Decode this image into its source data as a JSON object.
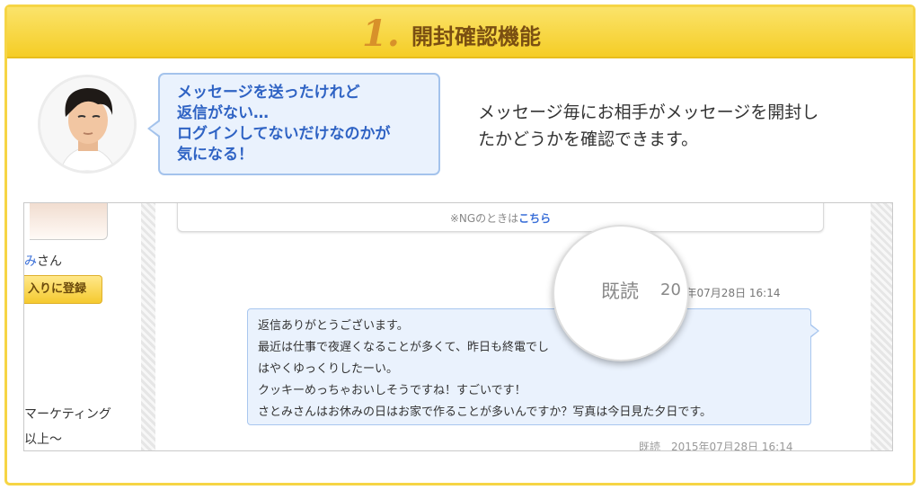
{
  "header": {
    "number": "1.",
    "title": "開封確認機能"
  },
  "bubble": {
    "lines": [
      "メッセージを送ったけれど",
      "返信がない…",
      "ログインしてないだけなのかが",
      "気になる！"
    ]
  },
  "description": {
    "lines": [
      "メッセージ毎にお相手がメッセージを開封し",
      "たかどうかを確認できます。"
    ]
  },
  "screenshot": {
    "notice_prefix": "※NGのときは",
    "notice_link": "こちら",
    "user_name_accent": "み",
    "user_name_suffix": "さん",
    "favorite_button": "入りに登録",
    "sidebar_text1": "マーケティング",
    "sidebar_text2": "以上〜",
    "status1": "2015年07月28日 16:14",
    "lens_read_label": "既読",
    "lens_number": "20",
    "message_lines": [
      "返信ありがとうございます。",
      "最近は仕事で夜遅くなることが多くて、昨日も終電でし",
      "はやくゆっくりしたーい。",
      "クッキーめっちゃおいしそうですね！すごいです！",
      "さとみさんはお休みの日はお家で作ることが多いんですか？写真は今日見た夕日です。"
    ],
    "status2": "既読　2015年07月28日 16:14"
  }
}
